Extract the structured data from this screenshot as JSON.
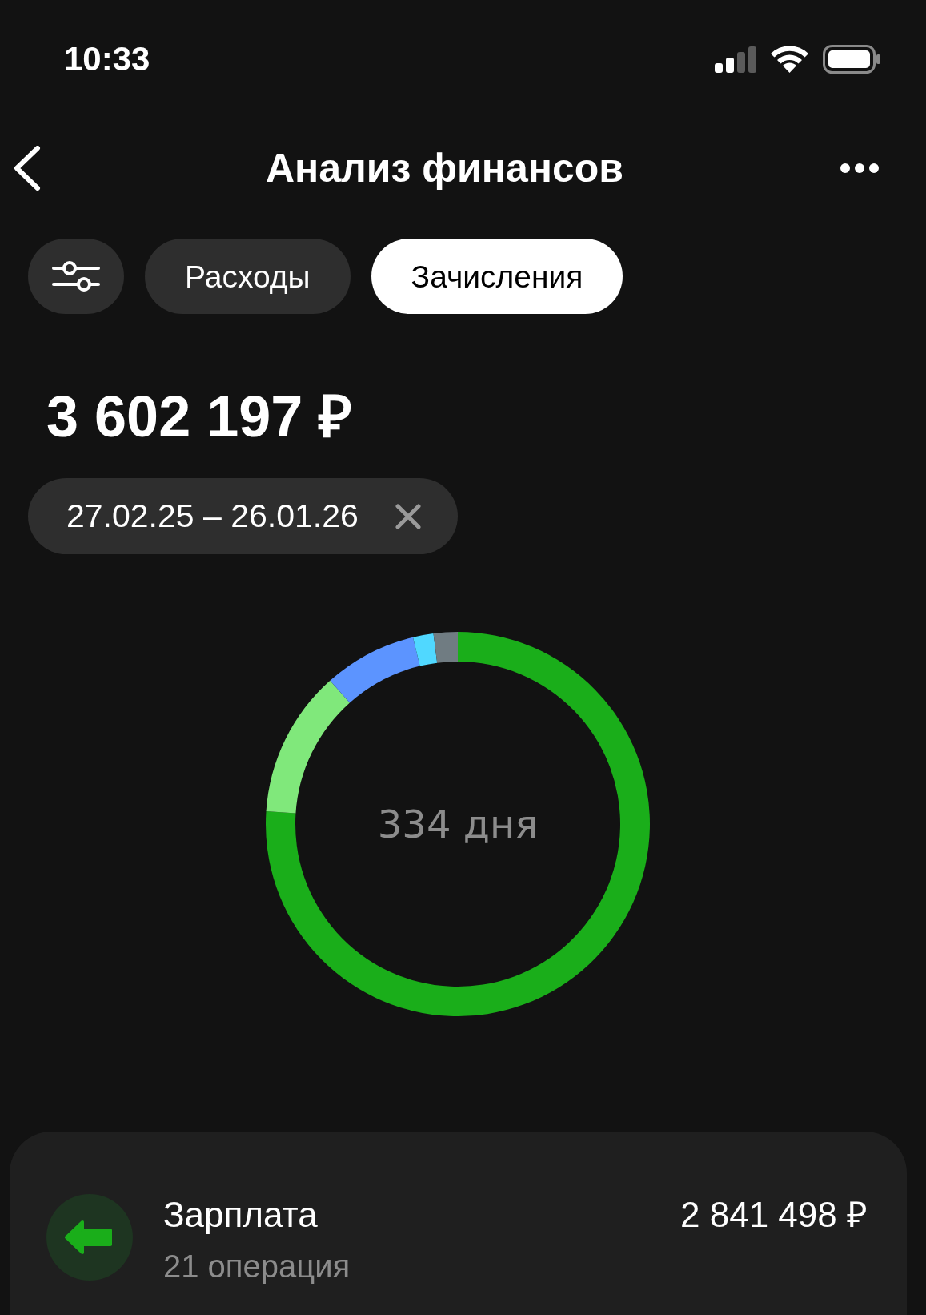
{
  "status_bar": {
    "time": "10:33"
  },
  "header": {
    "title": "Анализ финансов"
  },
  "tabs": [
    {
      "label": "Расходы",
      "selected": false
    },
    {
      "label": "Зачисления",
      "selected": true
    }
  ],
  "total": "3 602 197 ₽",
  "period_chip": {
    "label": "27.02.25 – 26.01.26"
  },
  "donut": {
    "center_label": "334 дня"
  },
  "categories": [
    {
      "name": "Зарплата",
      "operations": "21 операция",
      "amount": "2 841 498 ₽"
    }
  ]
}
